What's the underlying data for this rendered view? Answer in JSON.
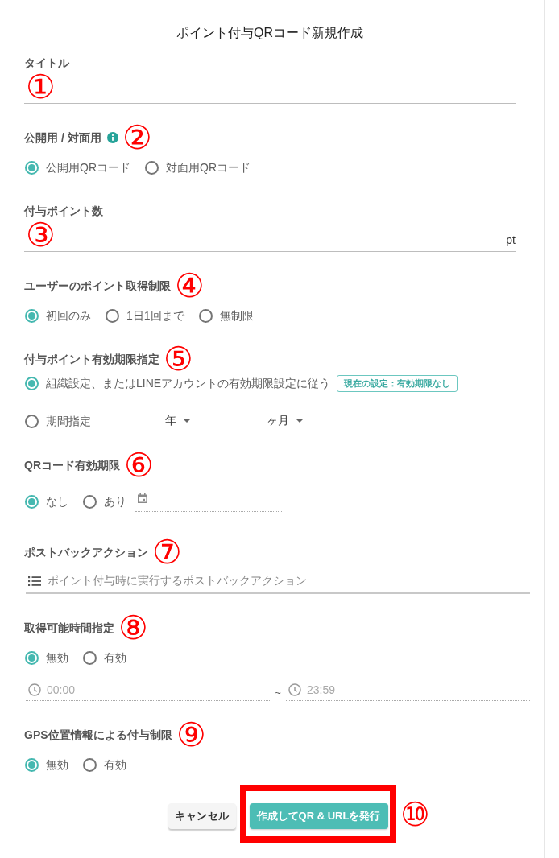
{
  "dialog": {
    "title": "ポイント付与QRコード新規作成"
  },
  "sections": [
    {
      "kind": "text_field",
      "label": "タイトル",
      "marker": "①"
    },
    {
      "kind": "radio",
      "label": "公開用 / 対面用",
      "info": true,
      "marker": "②",
      "options": [
        {
          "label": "公開用QRコード",
          "selected": true
        },
        {
          "label": "対面用QRコード",
          "selected": false
        }
      ]
    },
    {
      "kind": "text_field",
      "label": "付与ポイント数",
      "marker": "③",
      "suffix": "pt"
    },
    {
      "kind": "radio",
      "label": "ユーザーのポイント取得制限",
      "marker": "④",
      "options": [
        {
          "label": "初回のみ",
          "selected": true
        },
        {
          "label": "1日1回まで",
          "selected": false
        },
        {
          "label": "無制限",
          "selected": false
        }
      ]
    },
    {
      "kind": "radio_list",
      "label": "付与ポイント有効期限指定",
      "marker": "⑤",
      "options": [
        {
          "label": "組織設定、またはLINEアカウントの有効期限設定に従う",
          "selected": true,
          "badge": "現在の設定：有効期限なし"
        },
        {
          "label": "期間指定",
          "selected": false,
          "selects": [
            "年",
            "ヶ月"
          ]
        }
      ]
    },
    {
      "kind": "radio_date",
      "label": "QRコード有効期限",
      "marker": "⑥",
      "options": [
        {
          "label": "なし",
          "selected": true
        },
        {
          "label": "あり",
          "selected": false
        }
      ],
      "date_field": {
        "disabled": true
      }
    },
    {
      "kind": "postback",
      "label": "ポストバックアクション",
      "marker": "⑦",
      "placeholder": "ポイント付与時に実行するポストバックアクション"
    },
    {
      "kind": "radio_time",
      "label": "取得可能時間指定",
      "marker": "⑧",
      "options": [
        {
          "label": "無効",
          "selected": true
        },
        {
          "label": "有効",
          "selected": false
        }
      ],
      "time_from": {
        "value": "00:00",
        "disabled": true
      },
      "separator": "~",
      "time_to": {
        "value": "23:59",
        "disabled": true
      }
    },
    {
      "kind": "radio",
      "label": "GPS位置情報による付与制限",
      "marker": "⑨",
      "options": [
        {
          "label": "無効",
          "selected": true
        },
        {
          "label": "有効",
          "selected": false
        }
      ]
    }
  ],
  "actions": {
    "cancel": "キャンセル",
    "submit": {
      "label": "作成してQR & URLを発行",
      "highlighted": true,
      "marker": "⑩"
    }
  }
}
